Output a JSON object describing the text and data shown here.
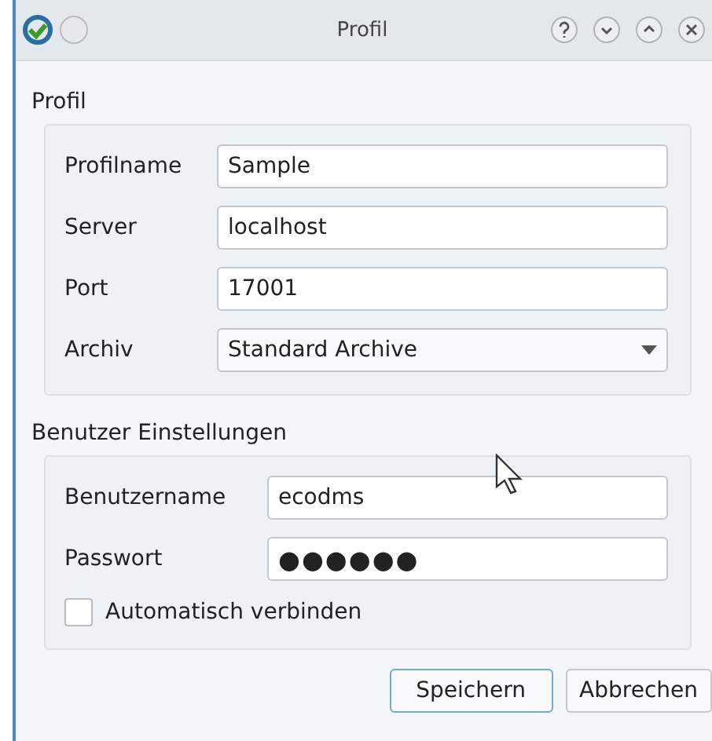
{
  "window": {
    "title": "Profil"
  },
  "profile_group": {
    "title": "Profil",
    "fields": [
      {
        "kind": "text",
        "label": "Profilname",
        "value": "Sample"
      },
      {
        "kind": "text",
        "label": "Server",
        "value": "localhost"
      },
      {
        "kind": "text",
        "label": "Port",
        "value": "17001"
      },
      {
        "kind": "dropdown",
        "label": "Archiv",
        "value": "Standard Archive"
      }
    ]
  },
  "user_group": {
    "title": "Benutzer Einstellungen",
    "fields": [
      {
        "kind": "text",
        "label": "Benutzername",
        "value": "ecodms"
      },
      {
        "kind": "password",
        "label": "Passwort",
        "value": "●●●●●●"
      }
    ],
    "checkbox": {
      "label": "Automatisch verbinden",
      "checked": false
    }
  },
  "buttons": [
    {
      "label": "Speichern",
      "default": true
    },
    {
      "label": "Abbrechen",
      "default": false
    }
  ]
}
